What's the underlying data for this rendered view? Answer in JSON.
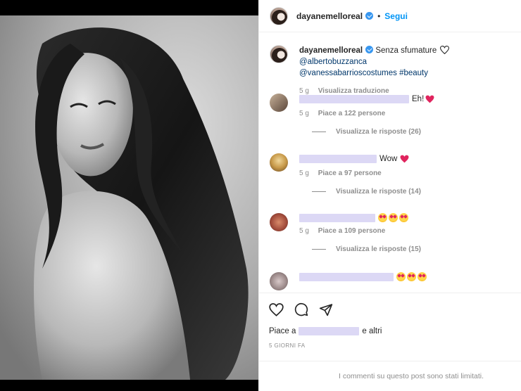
{
  "post": {
    "username": "dayanemelloreal",
    "follow_label": "Segui",
    "separator": "•"
  },
  "caption": {
    "username": "dayanemelloreal",
    "text": "Senza sfumature",
    "mention1": "@albertobuzzanca",
    "mention2": "@vanessabarrioscostumes",
    "hashtag": "#beauty",
    "age": "5 g",
    "translate_label": "Visualizza traduzione"
  },
  "comments": [
    {
      "text": "Eh!",
      "emoji": "red-heart",
      "age": "5 g",
      "likes": "Piace a 122 persone",
      "replies": "Visualizza le risposte (26)"
    },
    {
      "text": "Wow",
      "emoji": "red-heart",
      "age": "5 g",
      "likes": "Piace a 97 persone",
      "replies": "Visualizza le risposte (14)"
    },
    {
      "text": "",
      "emoji": "star-struck x3",
      "age": "5 g",
      "likes": "Piace a 109 persone",
      "replies": "Visualizza le risposte (15)"
    },
    {
      "text": "",
      "emoji": "star-struck x3"
    }
  ],
  "likes": {
    "prefix": "Piace a",
    "suffix": "e altri"
  },
  "date_label": "5 GIORNI FA",
  "limited_notice": "I commenti su questo post sono stati limitati.",
  "colors": {
    "link": "#0095f6",
    "mention": "#00376b",
    "heart": "#e0245e",
    "redaction": "#dcd8f5"
  },
  "icons": [
    "heart-icon",
    "comment-icon",
    "share-icon",
    "verified-badge-icon"
  ]
}
